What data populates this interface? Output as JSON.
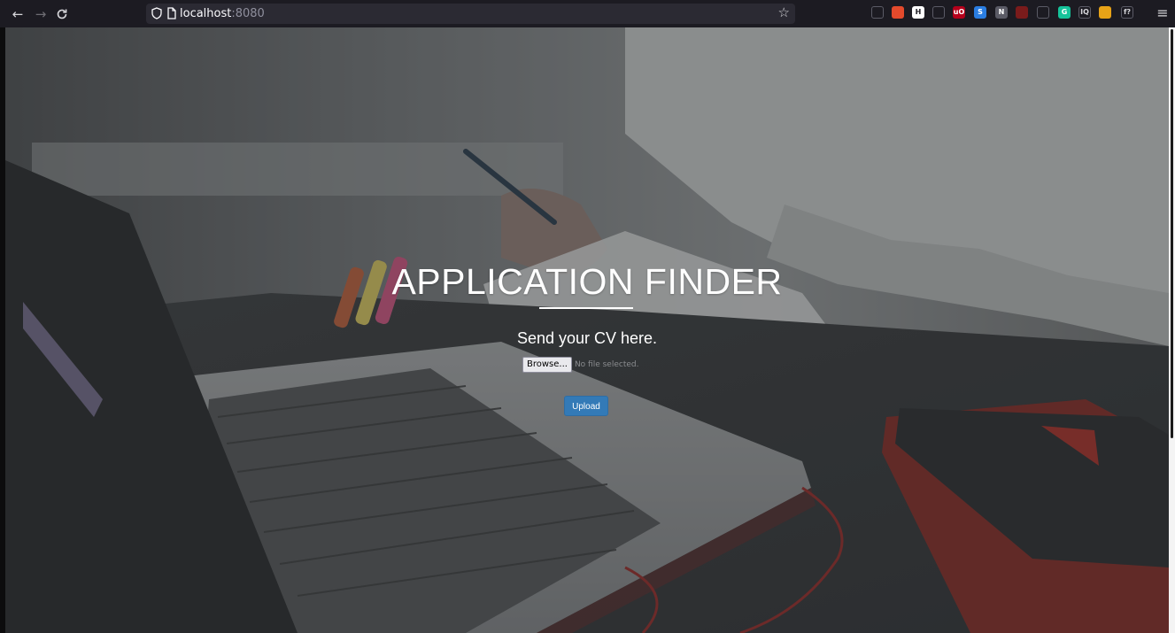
{
  "browser": {
    "url_host": "localhost",
    "url_port": ":8080",
    "icons": {
      "back": "back-arrow-icon",
      "forward": "forward-arrow-icon",
      "reload": "reload-icon",
      "tracking": "shield-icon",
      "page": "page-icon",
      "bookmark": "star-icon",
      "menu": "hamburger-menu-icon"
    },
    "extensions": [
      {
        "name": "pocket-icon",
        "label": "",
        "color": "#1c1b22"
      },
      {
        "name": "ext-download-icon",
        "label": "",
        "color": "#e34a2c"
      },
      {
        "name": "ext-h-icon",
        "label": "H",
        "color": "#ffffff"
      },
      {
        "name": "ext-glasses-icon",
        "label": "",
        "color": "#1c1b22"
      },
      {
        "name": "ublock-icon",
        "label": "uO",
        "color": "#b5001b"
      },
      {
        "name": "ext-s-icon",
        "label": "S",
        "color": "#2a7de1"
      },
      {
        "name": "ext-n-icon",
        "label": "N",
        "color": "#5b5b66"
      },
      {
        "name": "ext-dark-icon",
        "label": "",
        "color": "#7a1b1b"
      },
      {
        "name": "ext-leaf-icon",
        "label": "",
        "color": "#1c1b22"
      },
      {
        "name": "grammarly-icon",
        "label": "G",
        "color": "#15c39a"
      },
      {
        "name": "ext-iq-icon",
        "label": "IQ",
        "color": "#1c1b22"
      },
      {
        "name": "ext-color-icon",
        "label": "",
        "color": "#e8a317"
      },
      {
        "name": "ext-fx-icon",
        "label": "f?",
        "color": "#1c1b22"
      }
    ]
  },
  "page": {
    "title": "APPLICATION FINDER",
    "subtitle": "Send your CV here.",
    "browse_label": "Browse...",
    "file_status": "No file selected.",
    "upload_label": "Upload",
    "colors": {
      "upload_button": "#337ab7",
      "title_text": "#ffffff"
    }
  }
}
